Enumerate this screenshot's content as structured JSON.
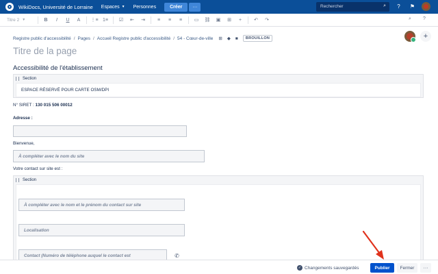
{
  "header": {
    "site_title": "WikiDocs, Université de Lorraine",
    "nav": [
      "Espaces",
      "Personnes"
    ],
    "create_label": "Créer",
    "more_label": "···",
    "search_placeholder": "Rechercher",
    "nav_color": "#0b4f99"
  },
  "toolbar": {
    "style_select": "Titre 2",
    "buttons": [
      "B",
      "I",
      "U",
      "A",
      "⋮≡",
      "1≡",
      "☑",
      "⇤",
      "⇥",
      "≡",
      "≡",
      "≡",
      "▭",
      "⛓",
      "▣",
      "⊞",
      "+",
      "↶",
      "↷"
    ]
  },
  "breadcrumb": {
    "items": [
      "Registre public d'accessibilité",
      "Pages",
      "Accueil Registre public d'accessibilité",
      "54 - Cœur-de-ville"
    ],
    "separator": "/",
    "draft_label": "BROUILLON"
  },
  "page": {
    "title_placeholder": "Titre de la page",
    "heading": "Accessibilité de l'établissement",
    "section1": {
      "label": "Section",
      "text": "ESPACE RÉSERVÉ POUR CARTE OSM/DPI"
    },
    "siret_label": "N° SIRET : ",
    "siret_value": "130 015 506 00012",
    "address_label": "Adresse :",
    "welcome_label": "Bienvenue,",
    "welcome_field": "À compléter avec le nom du site",
    "contact_label": "Votre contact sur site est :",
    "section2": {
      "label": "Section",
      "contact_name": "À compléter avec le nom et le prénom du contact sur site",
      "location": "Localisation",
      "phone": "Contact (Numéro de téléphone auquel le contact est"
    }
  },
  "footer": {
    "saved_text": "Changements sauvegardés",
    "publish_label": "Publier",
    "close_label": "Fermer",
    "more_label": "···"
  },
  "colors": {
    "publish": "#0052cc",
    "annotation_arrow": "#e0321c"
  }
}
